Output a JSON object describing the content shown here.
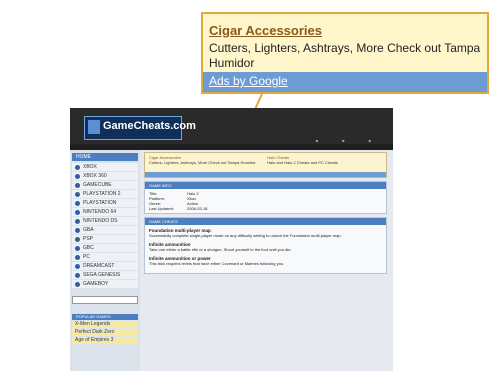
{
  "ad_callout": {
    "title": "Cigar Accessories",
    "description": "Cutters, Lighters, Ashtrays, More Check out Tampa Humidor",
    "ads_label": "Ads by Google"
  },
  "site": {
    "logo": "GameCheats.com",
    "nav_header": "HOME",
    "nav_items": [
      "XBOX",
      "XBOX 360",
      "GAMECUBE",
      "PLAYSTATION 2",
      "PLAYSTATION",
      "NINTENDO 64",
      "NINTENDO DS",
      "GBA",
      "PSP",
      "GBC",
      "PC",
      "DREAMCAST",
      "SEGA GENESIS",
      "GAMEBOY"
    ],
    "popular_header": "POPULAR GAMES",
    "popular_items": [
      "X-Men Legends",
      "Perfect Dark Zero",
      "Age of Empires 3"
    ],
    "ad_strip": {
      "ad1_title": "Cigar Accessories",
      "ad1_text": "Cutters, Lighters, Ashtrays, More Check out Tampa Humidor",
      "ad2_title": "Halo Cheats",
      "ad2_text": "Halo and Halo 2 Cheats and PC Cheats"
    },
    "game_info": {
      "header": "GAME INFO",
      "rows": [
        {
          "k": "Title:",
          "v": "Halo 2"
        },
        {
          "k": "Platform:",
          "v": "Xbox"
        },
        {
          "k": "Genre:",
          "v": "Action"
        },
        {
          "k": "Last Updated:",
          "v": "2006-03-18"
        }
      ]
    },
    "cheats": {
      "header": "GAME CHEATS",
      "sections": [
        {
          "title": "Foundation multi-player map",
          "text": "Successfully complete single-player mode on any difficulty setting to unlock the Foundation multi-player map."
        },
        {
          "title": "Infinite ammunition",
          "text": "Take one either a battle rifle or a shotgun. Shoot yourself in the foot until you die."
        },
        {
          "title": "Infinite ammunition or power",
          "text": "This trick requires levels that have either Covenant or Marines following you."
        }
      ]
    }
  }
}
